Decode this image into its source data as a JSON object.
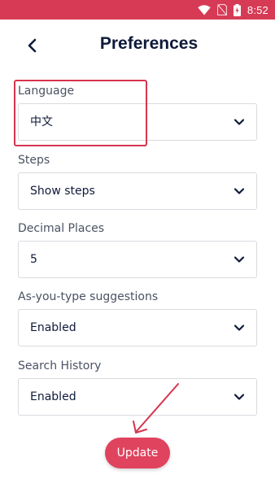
{
  "status_bar": {
    "time": "8:52",
    "background": "#d63a55",
    "icons": [
      "wifi-icon",
      "no-sim-icon",
      "battery-charging-icon"
    ]
  },
  "header": {
    "back_icon": "chevron-left-icon",
    "title": "Preferences"
  },
  "fields": [
    {
      "label": "Language",
      "value": "中文"
    },
    {
      "label": "Steps",
      "value": "Show steps"
    },
    {
      "label": "Decimal Places",
      "value": "5"
    },
    {
      "label": "As-you-type suggestions",
      "value": "Enabled"
    },
    {
      "label": "Search History",
      "value": "Enabled"
    }
  ],
  "update_button": {
    "label": "Update",
    "color": "#e0435e"
  },
  "annotations": {
    "highlight_color": "#d6344e"
  }
}
